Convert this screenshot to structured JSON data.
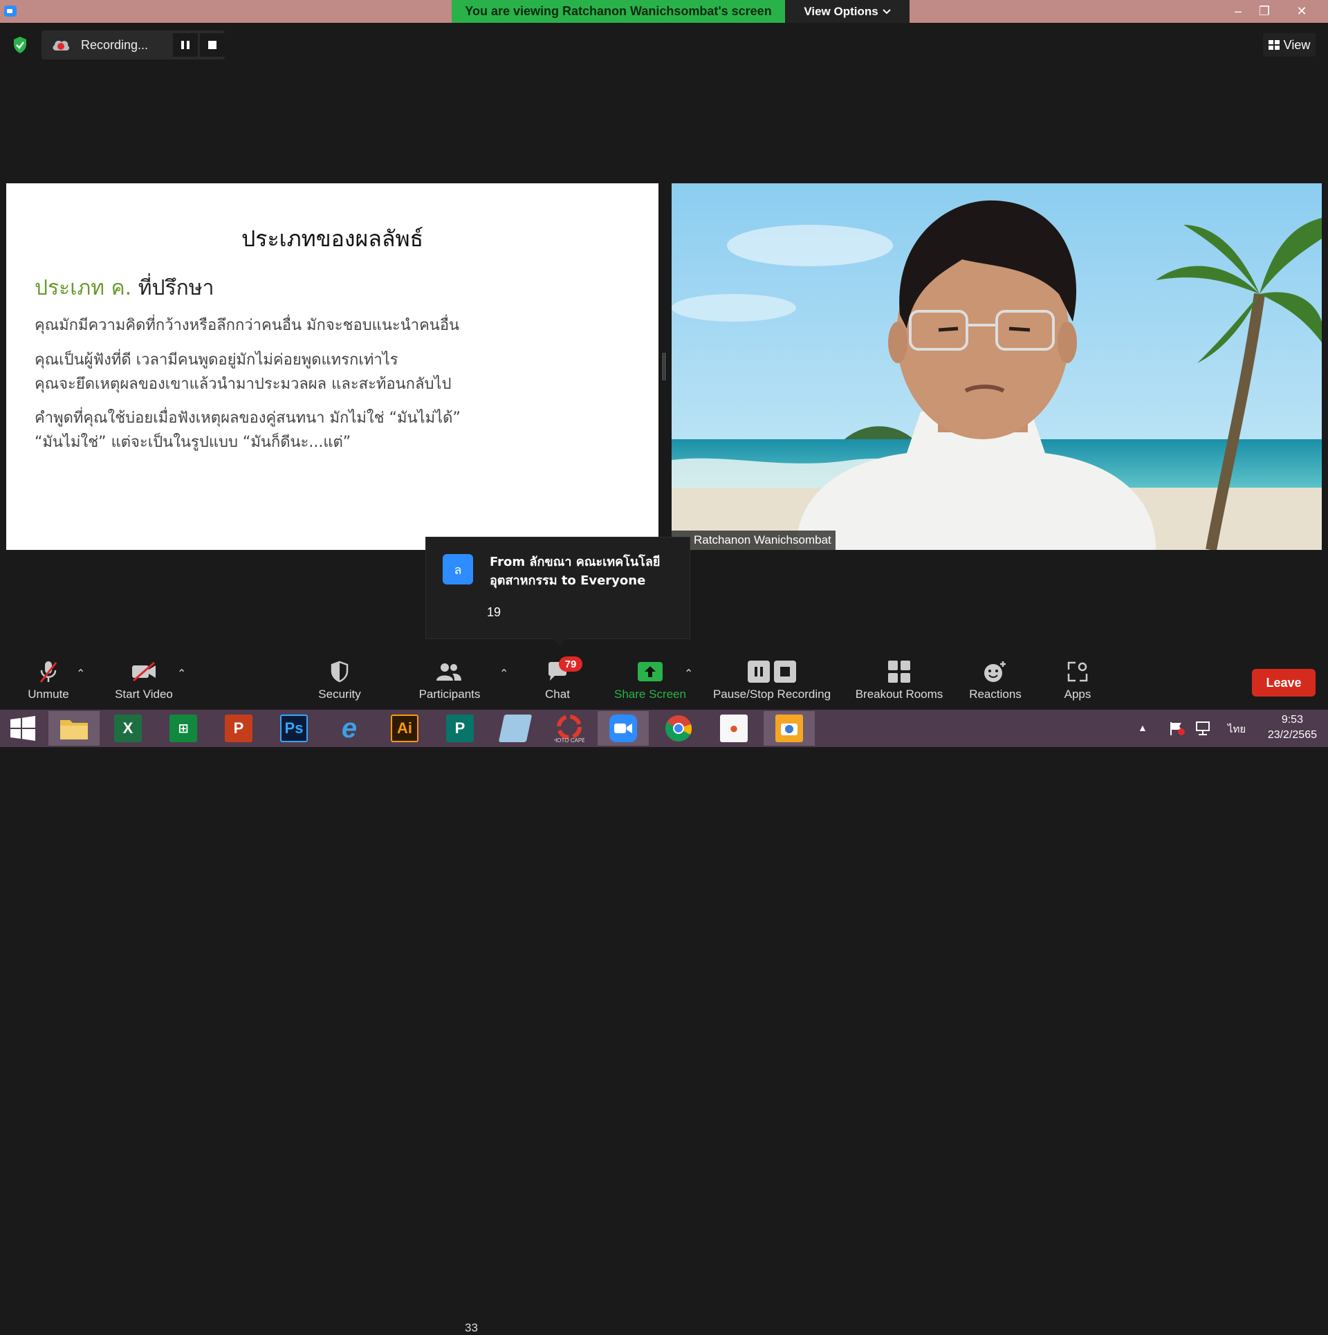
{
  "title_bar": {
    "viewing_banner": "You are viewing Ratchanon Wanichsombat's screen",
    "view_options_label": "View Options",
    "minimize": "–",
    "restore": "❐",
    "close": "✕"
  },
  "recording": {
    "label": "Recording..."
  },
  "view_button_label": "View",
  "slide": {
    "title": "ประเภทของผลลัพธ์",
    "heading_accent": "ประเภท ค.",
    "heading_rest": " ที่ปรึกษา",
    "paragraphs": [
      "คุณมักมีความคิดที่กว้างหรือลึกกว่าคนอื่น มักจะชอบแนะนำคนอื่น",
      "คุณเป็นผู้ฟังที่ดี เวลามีคนพูดอยู่มักไม่ค่อยพูดแทรกเท่าไร\nคุณจะยึดเหตุผลของเขาแล้วนำมาประมวลผล และสะท้อนกลับไป",
      "คำพูดที่คุณใช้บ่อยเมื่อฟังเหตุผลของคู่สนทนา มักไม่ใช่ “มันไม่ได้”\n“มันไม่ใช่” แต่จะเป็นในรูปแบบ “มันก็ดีนะ...แต่”"
    ]
  },
  "video": {
    "participant_name": "Ratchanon Wanichsombat"
  },
  "chat_toast": {
    "avatar_letter": "ล",
    "from_text": "From ลักขณา คณะเทคโนโลยีอุตสาหกรรม to Everyone",
    "message": "19"
  },
  "toolbar": {
    "unmute": "Unmute",
    "start_video": "Start Video",
    "security": "Security",
    "participants": "Participants",
    "participants_count": "33",
    "chat": "Chat",
    "chat_badge": "79",
    "share_screen": "Share Screen",
    "pause_stop_recording": "Pause/Stop Recording",
    "breakout_rooms": "Breakout Rooms",
    "reactions": "Reactions",
    "apps": "Apps",
    "leave": "Leave",
    "caret": "⌃"
  },
  "taskbar": {
    "apps": [
      "Excel",
      "Store",
      "PowerPoint",
      "Photoshop",
      "Internet Explorer",
      "Illustrator",
      "Publisher",
      "Notepad",
      "PhotoScape",
      "Zoom",
      "Chrome",
      "Paint",
      "Camera"
    ],
    "photoscape_caption": "HOTO CAPE",
    "language": "ไทย",
    "time": "9:53",
    "date": "23/2/2565"
  },
  "colors": {
    "banner_green": "#2ab24a",
    "titlebar": "#c08a87",
    "leave_red": "#d52b1e",
    "badge_red": "#e02828",
    "slide_accent": "#6a9a2e",
    "zoom_blue": "#2d8cff",
    "taskbar": "#4e3b4d"
  }
}
